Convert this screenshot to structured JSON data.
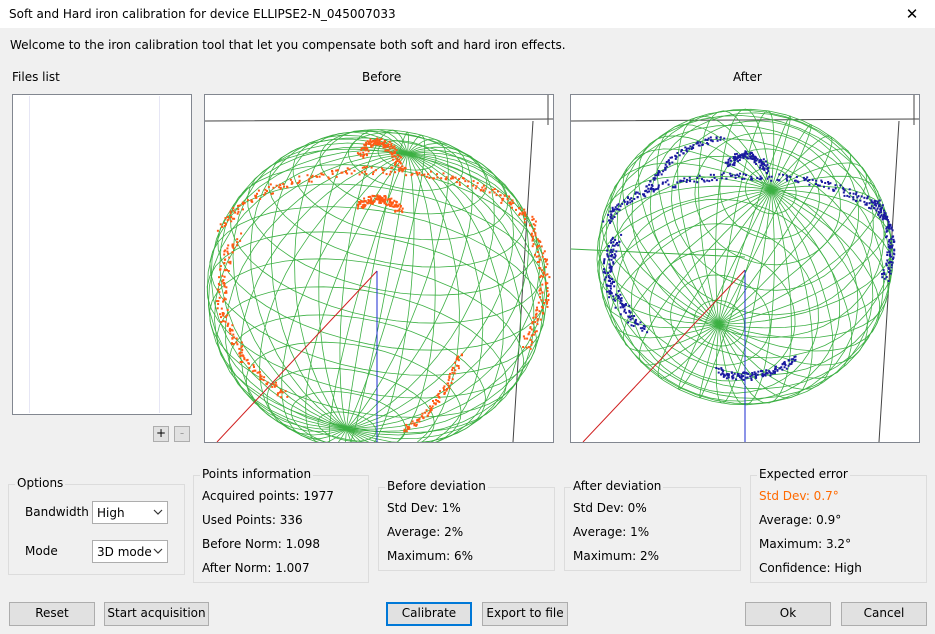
{
  "window": {
    "title": "Soft and Hard iron calibration for device ELLIPSE2-N_045007033",
    "close_glyph": "✕"
  },
  "welcome_text": "Welcome to the iron calibration tool that let you compensate both soft and hard iron effects.",
  "files": {
    "label": "Files list",
    "add_glyph": "+",
    "remove_glyph": "-"
  },
  "viewers": {
    "before_label": "Before",
    "after_label": "After"
  },
  "options": {
    "title": "Options",
    "bandwidth_label": "Bandwidth",
    "bandwidth_value": "High",
    "mode_label": "Mode",
    "mode_value": "3D mode"
  },
  "points_info": {
    "title": "Points information",
    "acquired": "Acquired points: 1977",
    "used": "Used Points: 336",
    "before_norm": "Before Norm: 1.098",
    "after_norm": "After Norm: 1.007"
  },
  "before_deviation": {
    "title": "Before deviation",
    "std_dev": "Std Dev: 1%",
    "average": "Average: 2%",
    "maximum": "Maximum: 6%"
  },
  "after_deviation": {
    "title": "After deviation",
    "std_dev": "Std Dev: 0%",
    "average": "Average: 1%",
    "maximum": "Maximum: 2%"
  },
  "expected_error": {
    "title": "Expected error",
    "std_dev": "Std Dev: 0.7°",
    "average": "Average: 0.9°",
    "maximum": "Maximum: 3.2°",
    "confidence": "Confidence: High"
  },
  "buttons": {
    "reset": "Reset",
    "start_acquisition": "Start acquisition",
    "calibrate": "Calibrate",
    "export": "Export to file",
    "ok": "Ok",
    "cancel": "Cancel"
  },
  "colors": {
    "sphere_mesh": "#3cb043",
    "before_points": "#ff5a14",
    "after_points": "#1a1aa0",
    "axis_x": "#d02020",
    "axis_z": "#1a2ad0",
    "expected_std_dev": "#ff6a00"
  }
}
